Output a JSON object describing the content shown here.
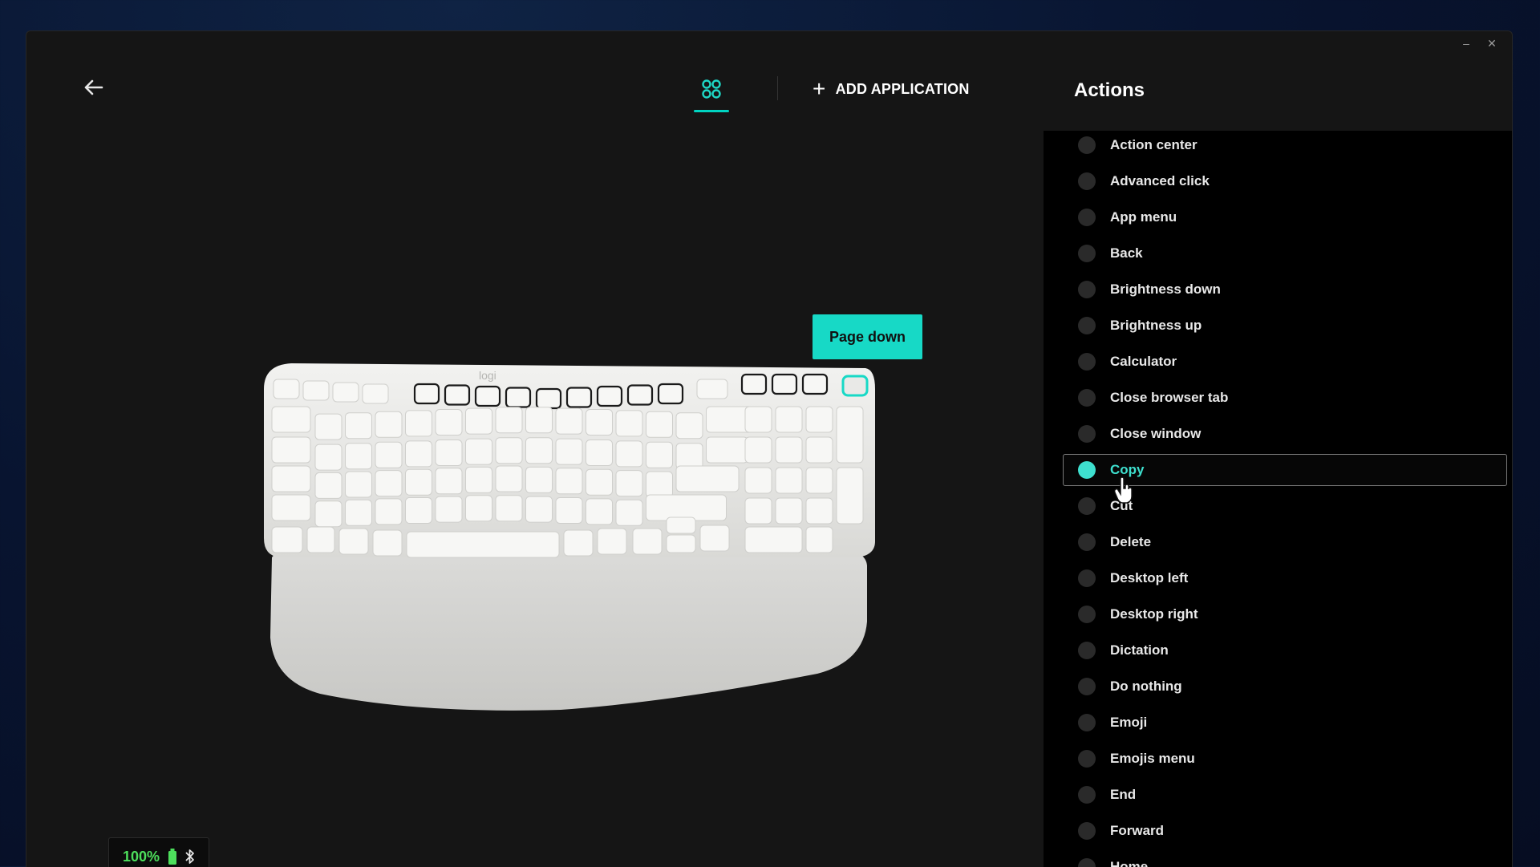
{
  "window": {
    "minimize_label": "–",
    "close_label": "✕"
  },
  "header": {
    "back_icon": "back-arrow-icon",
    "all_apps_icon": "all-apps-grid-icon",
    "add_application_label": "ADD APPLICATION"
  },
  "device": {
    "logo_text": "logi",
    "hovered_key_tooltip": "Page down",
    "battery_percent": "100%",
    "accent_color": "#17d9c6",
    "battery_color": "#4ddf5c"
  },
  "actions_panel": {
    "title": "Actions",
    "selected": "Copy",
    "items": [
      {
        "label": "Action center"
      },
      {
        "label": "Advanced click"
      },
      {
        "label": "App menu"
      },
      {
        "label": "Back"
      },
      {
        "label": "Brightness down"
      },
      {
        "label": "Brightness up"
      },
      {
        "label": "Calculator"
      },
      {
        "label": "Close browser tab"
      },
      {
        "label": "Close window"
      },
      {
        "label": "Copy"
      },
      {
        "label": "Cut"
      },
      {
        "label": "Delete"
      },
      {
        "label": "Desktop left"
      },
      {
        "label": "Desktop right"
      },
      {
        "label": "Dictation"
      },
      {
        "label": "Do nothing"
      },
      {
        "label": "Emoji"
      },
      {
        "label": "Emojis menu"
      },
      {
        "label": "End"
      },
      {
        "label": "Forward"
      },
      {
        "label": "Home"
      }
    ]
  }
}
